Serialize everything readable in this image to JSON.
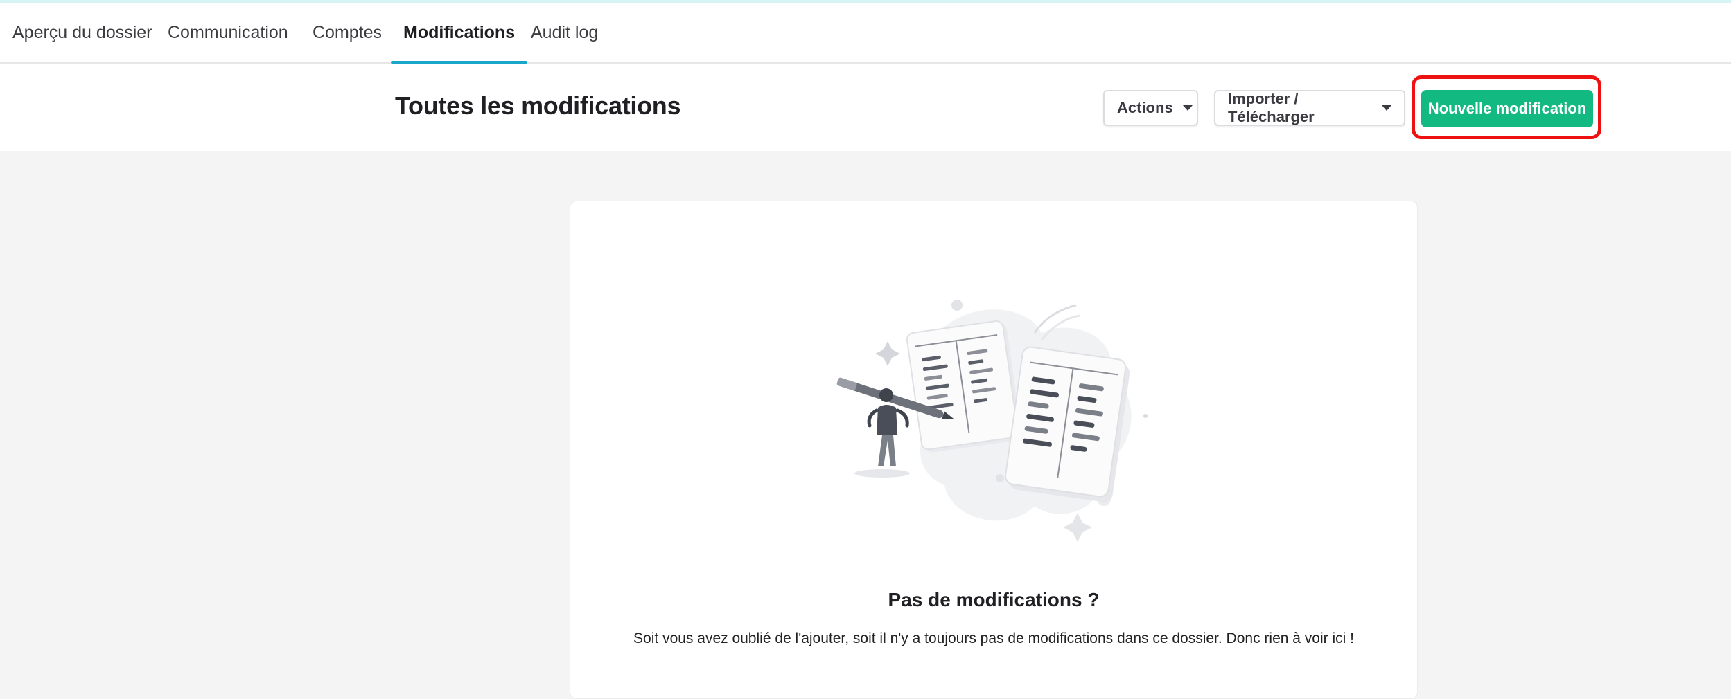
{
  "tabs": [
    {
      "label": "Aperçu du dossier",
      "active": false
    },
    {
      "label": "Communication",
      "active": false
    },
    {
      "label": "Comptes",
      "active": false
    },
    {
      "label": "Modifications",
      "active": true
    },
    {
      "label": "Audit log",
      "active": false
    }
  ],
  "header": {
    "title": "Toutes les modifications",
    "actions_label": "Actions",
    "import_label": "Importer / Télécharger",
    "new_label": "Nouvelle modification"
  },
  "empty_state": {
    "title": "Pas de modifications ?",
    "description": "Soit vous avez oublié de l'ajouter, soit il n'y a toujours pas de modifications dans ce dossier. Donc rien à voir ici !",
    "illustration": "person-carrying-pen-documents-illustration"
  },
  "colors": {
    "primary": "#12b981",
    "tab_active_underline": "#19a6c9",
    "highlight": "#ee1111",
    "background": "#f4f4f5"
  }
}
